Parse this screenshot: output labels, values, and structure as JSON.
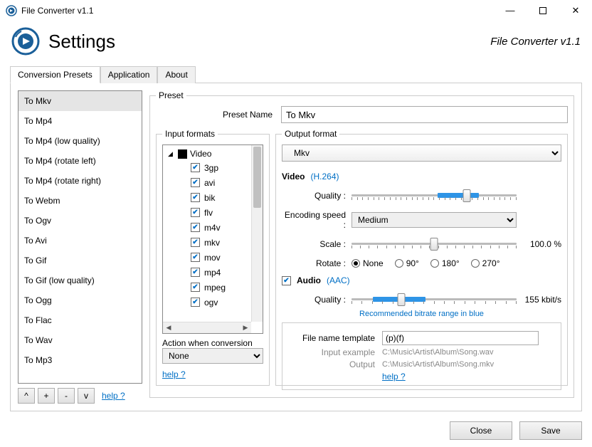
{
  "titlebar": {
    "title": "File Converter v1.1"
  },
  "header": {
    "title": "Settings",
    "version": "File Converter v1.1"
  },
  "tabs": {
    "t0": "Conversion Presets",
    "t1": "Application",
    "t2": "About"
  },
  "presets": {
    "p0": "To Mkv",
    "p1": "To Mp4",
    "p2": "To Mp4 (low quality)",
    "p3": "To Mp4 (rotate left)",
    "p4": "To Mp4 (rotate right)",
    "p5": "To Webm",
    "p6": "To Ogv",
    "p7": "To Avi",
    "p8": "To Gif",
    "p9": "To Gif (low quality)",
    "p10": "To Ogg",
    "p11": "To Flac",
    "p12": "To Wav",
    "p13": "To Mp3"
  },
  "leftButtons": {
    "up": "^",
    "add": "+",
    "remove": "-",
    "down": "v",
    "help": "help ?"
  },
  "preset": {
    "legend": "Preset",
    "nameLabel": "Preset Name",
    "nameValue": "To Mkv"
  },
  "inputFormats": {
    "legend": "Input formats",
    "root": "Video",
    "f0": "3gp",
    "f1": "avi",
    "f2": "bik",
    "f3": "flv",
    "f4": "m4v",
    "f5": "mkv",
    "f6": "mov",
    "f7": "mp4",
    "f8": "mpeg",
    "f9": "ogv",
    "actionLabel": "Action when conversion",
    "actionValue": "None",
    "help": "help ?"
  },
  "output": {
    "legend": "Output format",
    "format": "Mkv",
    "video": {
      "title": "Video",
      "codec": "(H.264)",
      "qualityLabel": "Quality :",
      "speedLabel": "Encoding speed :",
      "speedValue": "Medium",
      "scaleLabel": "Scale :",
      "scaleValue": "100.0 %",
      "rotateLabel": "Rotate :",
      "r0": "None",
      "r1": "90°",
      "r2": "180°",
      "r3": "270°"
    },
    "audio": {
      "title": "Audio",
      "codec": "(AAC)",
      "qualityLabel": "Quality :",
      "qualityValue": "155 kbit/s",
      "reco": "Recommended bitrate range in blue"
    },
    "template": {
      "nameLabel": "File name template",
      "nameValue": "(p)(f)",
      "inputExLabel": "Input example",
      "inputExValue": "C:\\Music\\Artist\\Album\\Song.wav",
      "outputLabel": "Output",
      "outputValue": "C:\\Music\\Artist\\Album\\Song.mkv",
      "help": "help ?"
    }
  },
  "bottom": {
    "close": "Close",
    "save": "Save"
  }
}
